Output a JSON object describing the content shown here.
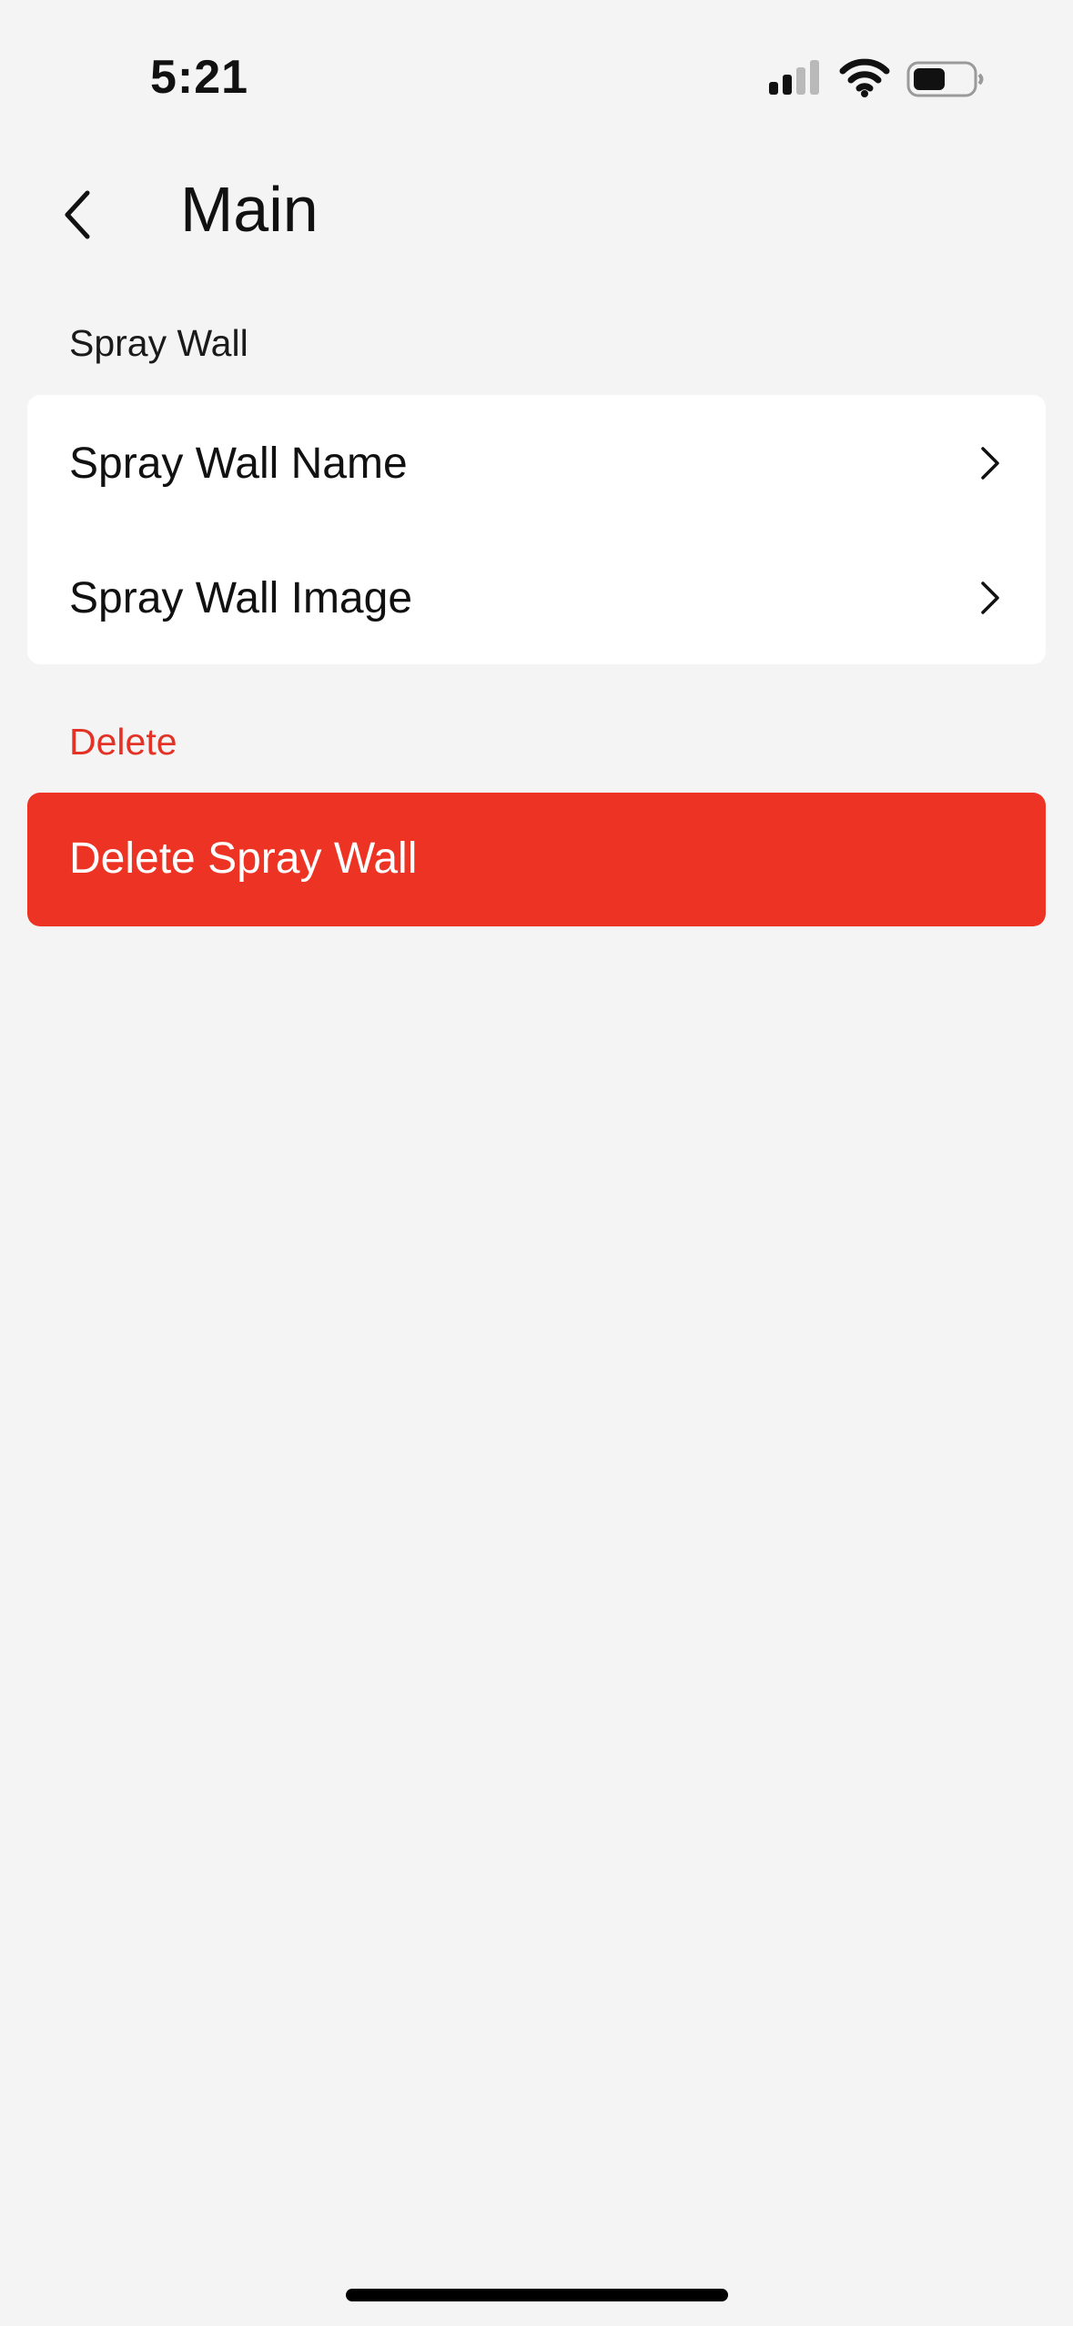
{
  "status_bar": {
    "time": "5:21",
    "icons": [
      "signal-icon",
      "wifi-icon",
      "battery-icon"
    ]
  },
  "nav": {
    "title": "Main",
    "back_icon": "chevron-left-icon"
  },
  "sections": {
    "spray_wall": {
      "header": "Spray Wall",
      "rows": [
        {
          "label": "Spray Wall Name",
          "icon": "chevron-right-icon"
        },
        {
          "label": "Spray Wall Image",
          "icon": "chevron-right-icon"
        }
      ]
    },
    "delete": {
      "header": "Delete",
      "button_label": "Delete Spray Wall"
    }
  },
  "colors": {
    "background": "#f4f4f4",
    "card": "#ffffff",
    "destructive": "#ec3324",
    "destructive_text": "#e33226"
  }
}
